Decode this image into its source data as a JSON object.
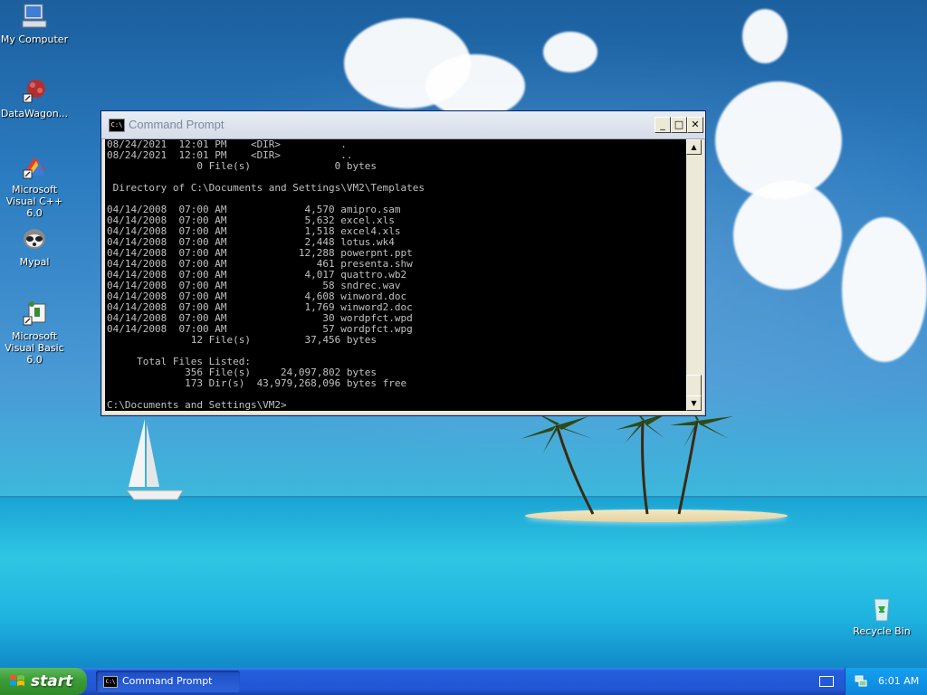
{
  "desktop": {
    "icons": [
      {
        "label": "My Computer"
      },
      {
        "label": "DataWagon..."
      },
      {
        "label": "Microsoft Visual C++ 6.0"
      },
      {
        "label": "Mypal"
      },
      {
        "label": "Microsoft Visual Basic 6.0"
      },
      {
        "label": "Recycle Bin"
      }
    ]
  },
  "window": {
    "title": "Command Prompt",
    "title_icon_text": "C:\\",
    "minimize_glyph": "_",
    "maximize_glyph": "□",
    "close_glyph": "✕",
    "console_lines": [
      "08/24/2021  12:01 PM    <DIR>          .",
      "08/24/2021  12:01 PM    <DIR>          ..",
      "               0 File(s)              0 bytes",
      "",
      " Directory of C:\\Documents and Settings\\VM2\\Templates",
      "",
      "04/14/2008  07:00 AM             4,570 amipro.sam",
      "04/14/2008  07:00 AM             5,632 excel.xls",
      "04/14/2008  07:00 AM             1,518 excel4.xls",
      "04/14/2008  07:00 AM             2,448 lotus.wk4",
      "04/14/2008  07:00 AM            12,288 powerpnt.ppt",
      "04/14/2008  07:00 AM               461 presenta.shw",
      "04/14/2008  07:00 AM             4,017 quattro.wb2",
      "04/14/2008  07:00 AM                58 sndrec.wav",
      "04/14/2008  07:00 AM             4,608 winword.doc",
      "04/14/2008  07:00 AM             1,769 winword2.doc",
      "04/14/2008  07:00 AM                30 wordpfct.wpd",
      "04/14/2008  07:00 AM                57 wordpfct.wpg",
      "              12 File(s)         37,456 bytes",
      "",
      "     Total Files Listed:",
      "             356 File(s)     24,097,802 bytes",
      "             173 Dir(s)  43,979,268,096 bytes free",
      "",
      "C:\\Documents and Settings\\VM2>"
    ],
    "scroll_up_glyph": "▲",
    "scroll_down_glyph": "▼"
  },
  "taskbar": {
    "start_label": "start",
    "tasks": [
      {
        "label": "Command Prompt",
        "icon_text": "C:\\"
      }
    ],
    "clock": "6:01 AM"
  },
  "icons": {
    "window": "cmd-icon",
    "tray": [
      "keyboard-icon",
      "network-icon"
    ]
  },
  "colors": {
    "console_bg": "#000000",
    "console_fg": "#c0c0c0",
    "taskbar": "#245edb",
    "start_button": "#3c9c36"
  }
}
